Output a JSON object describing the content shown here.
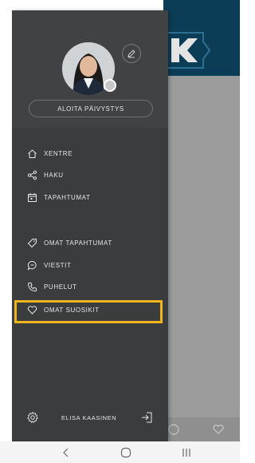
{
  "drawer": {
    "shift_button_label": "ALOITA PÄIVYSTYS",
    "nav_items": [
      {
        "label": "XENTRE",
        "icon": "home-icon"
      },
      {
        "label": "HAKU",
        "icon": "share-icon"
      },
      {
        "label": "TAPAHTUMAT",
        "icon": "calendar-icon"
      },
      {
        "label": "OMAT TAPAHTUMAT",
        "icon": "tag-icon"
      },
      {
        "label": "VIESTIT",
        "icon": "chat-icon"
      },
      {
        "label": "PUHELUT",
        "icon": "phone-icon"
      },
      {
        "label": "OMAT SUOSIKIT",
        "icon": "heart-icon"
      }
    ],
    "user_name": "ELISA KAASINEN"
  },
  "colors": {
    "drawer_bg": "#3b3c3d",
    "highlight": "#f0b51e",
    "header_bg": "#0c3d57"
  }
}
